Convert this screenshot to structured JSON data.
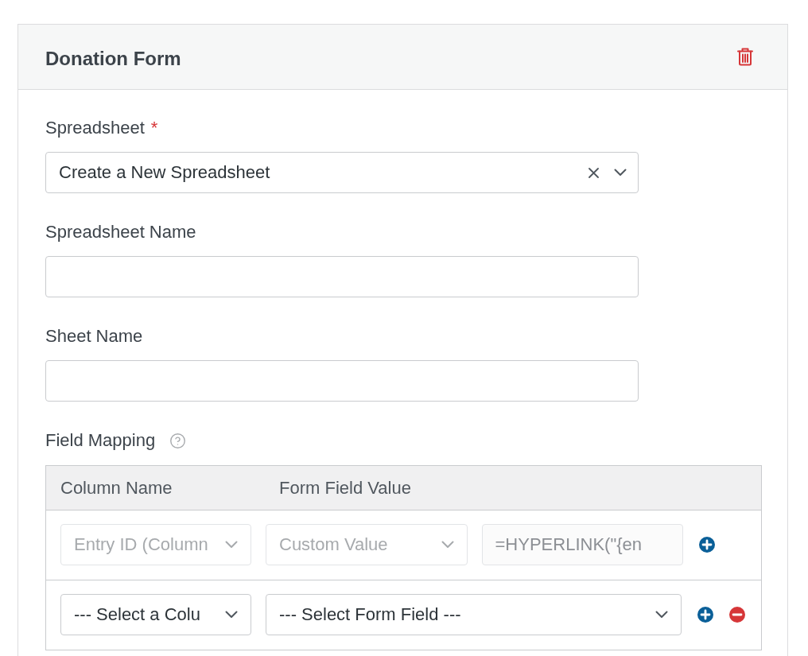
{
  "panel": {
    "title": "Donation Form"
  },
  "fields": [
    {
      "kind": "select",
      "label": "Spreadsheet",
      "required_mark": "*",
      "value": "Create a New Spreadsheet",
      "clearable": true
    },
    {
      "kind": "text",
      "label": "Spreadsheet Name"
    },
    {
      "kind": "text",
      "label": "Sheet Name"
    }
  ],
  "field_mapping": {
    "label": "Field Mapping",
    "columns": [
      "Column Name",
      "Form Field Value"
    ],
    "rows": [
      {
        "disabled": true,
        "column": "Entry ID (Column",
        "form_field": "Custom Value",
        "custom_value": "=HYPERLINK(\"{en",
        "removable": false
      },
      {
        "disabled": false,
        "column": "--- Select a Colu",
        "form_field": "--- Select Form Field ---",
        "removable": true
      }
    ]
  }
}
